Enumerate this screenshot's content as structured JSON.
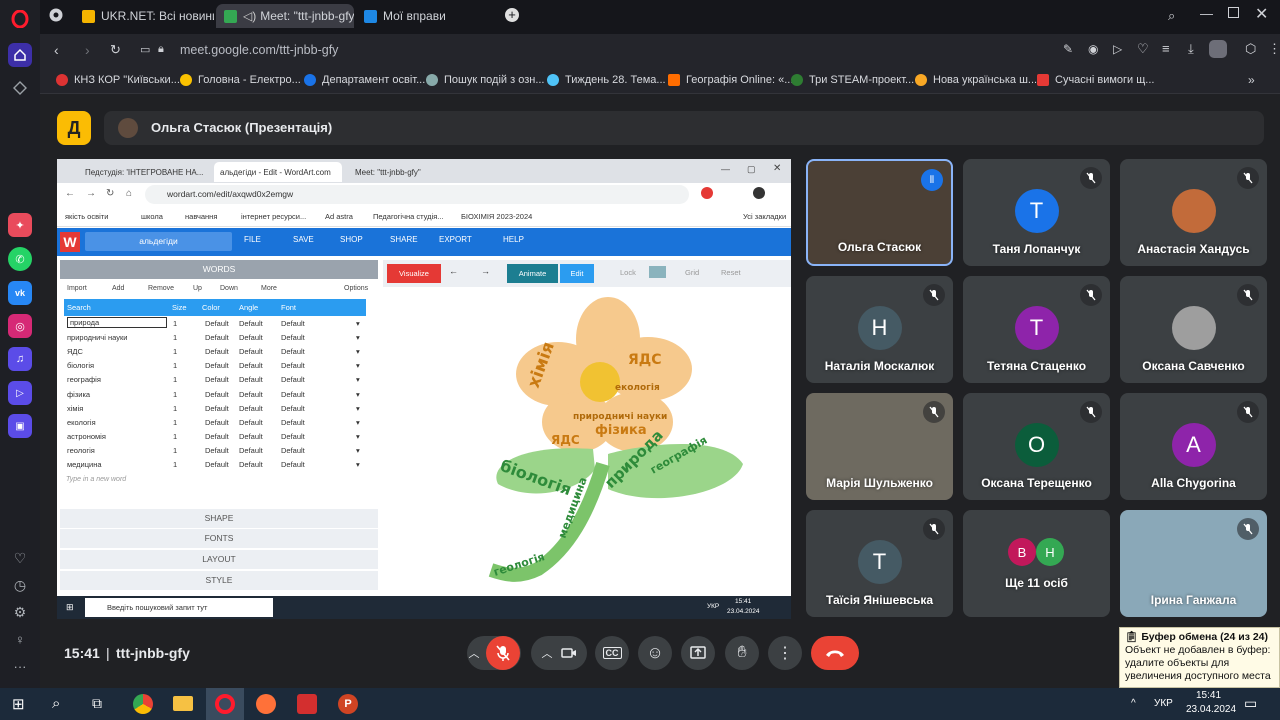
{
  "browser": {
    "tabs": [
      {
        "label": "UKR.NET: Всі новини Укр"
      },
      {
        "label": "Meet: \"ttt-jnbb-gfy\""
      },
      {
        "label": "Мої вправи"
      }
    ],
    "url": "meet.google.com/ttt-jnbb-gfy",
    "bookmarks": [
      "КНЗ КОР \"Київськи...",
      "Головна - Електро...",
      "Департамент освіт...",
      "Пошук подій з озн...",
      "Тиждень 28. Тема...",
      "Географія Online: «...",
      "Три STEAM-проект...",
      "Нова українська ш...",
      "Сучасні вимоги щ..."
    ]
  },
  "meet": {
    "logo_letter": "Д",
    "presenter": "Ольга Стасюк (Презентація)",
    "time": "15:41",
    "code": "ttt-jnbb-gfy",
    "participants": [
      {
        "name": "Ольга Стасюк",
        "initial": "",
        "color": "#6b5a4c"
      },
      {
        "name": "Таня Лопанчук",
        "initial": "Т",
        "color": "#1a73e8"
      },
      {
        "name": "Анастасія Хандусь",
        "initial": "",
        "color": "#c26b3a"
      },
      {
        "name": "Наталія Москалюк",
        "initial": "Н",
        "color": "#455a64"
      },
      {
        "name": "Тетяна Стаценко",
        "initial": "Т",
        "color": "#8e24aa"
      },
      {
        "name": "Оксана Савченко",
        "initial": "",
        "color": "#9e9e9e"
      },
      {
        "name": "Марія Шульженко",
        "initial": "",
        "color": "#7a6a58"
      },
      {
        "name": "Оксана Терещенко",
        "initial": "О",
        "color": "#0b5d3b"
      },
      {
        "name": "Alla Chygorina",
        "initial": "A",
        "color": "#8e24aa"
      },
      {
        "name": "Таїсія Янішевська",
        "initial": "Т",
        "color": "#455a64"
      },
      {
        "name": "Ще 11 осіб",
        "initial": "",
        "color": "#3c4043"
      },
      {
        "name": "Ірина Ганжала",
        "initial": "",
        "color": "#6f93a8"
      }
    ],
    "more_avatars": [
      "В",
      "Н"
    ]
  },
  "shared": {
    "tabs": [
      "Педстудія: 'ІНТЕГРОВАНЕ НА...",
      "альдегіди - Edit - WordArt.com",
      "Meet: \"ttt-jnbb-gfy\""
    ],
    "url": "wordart.com/edit/axqwd0x2emgw",
    "bookmarks": [
      "якість освіти",
      "школа",
      "навчання",
      "інтернет ресурси...",
      "Ad astra",
      "Педагогічна студія...",
      "БІОХІМІЯ 2023-2024",
      "Усі закладки"
    ],
    "wordart": {
      "title": "альдегіди",
      "menu": [
        "FILE",
        "SAVE",
        "SHOP",
        "SHARE",
        "EXPORT",
        "HELP"
      ],
      "words_header": "WORDS",
      "toolbar": [
        "Import",
        "Add",
        "Remove",
        "Up",
        "Down",
        "More",
        "Options"
      ],
      "columns": [
        "Search",
        "Size",
        "Color",
        "Angle",
        "Font"
      ],
      "rows": [
        {
          "word": "природа",
          "size": "1",
          "color": "Default",
          "angle": "Default",
          "font": "Default"
        },
        {
          "word": "природничі науки",
          "size": "1",
          "color": "Default",
          "angle": "Default",
          "font": "Default"
        },
        {
          "word": "ЯДС",
          "size": "1",
          "color": "Default",
          "angle": "Default",
          "font": "Default"
        },
        {
          "word": "біологія",
          "size": "1",
          "color": "Default",
          "angle": "Default",
          "font": "Default"
        },
        {
          "word": "географія",
          "size": "1",
          "color": "Default",
          "angle": "Default",
          "font": "Default"
        },
        {
          "word": "фізика",
          "size": "1",
          "color": "Default",
          "angle": "Default",
          "font": "Default"
        },
        {
          "word": "хімія",
          "size": "1",
          "color": "Default",
          "angle": "Default",
          "font": "Default"
        },
        {
          "word": "екологія",
          "size": "1",
          "color": "Default",
          "angle": "Default",
          "font": "Default"
        },
        {
          "word": "астрономія",
          "size": "1",
          "color": "Default",
          "angle": "Default",
          "font": "Default"
        },
        {
          "word": "геологія",
          "size": "1",
          "color": "Default",
          "angle": "Default",
          "font": "Default"
        },
        {
          "word": "медицина",
          "size": "1",
          "color": "Default",
          "angle": "Default",
          "font": "Default"
        }
      ],
      "new_word_placeholder": "Type in a new word",
      "sections": [
        "SHAPE",
        "FONTS",
        "LAYOUT",
        "STYLE"
      ],
      "canvas_toolbar": [
        "Visualize",
        "Animate",
        "Edit",
        "Lock",
        "Grid",
        "Reset"
      ]
    },
    "taskbar": {
      "search": "Введіть пошуковий запит тут",
      "lang": "УКР",
      "time": "15:41",
      "date": "23.04.2024"
    }
  },
  "clipboard": {
    "title": "Буфер обмена (24 из 24)",
    "message": "Объект не добавлен в буфер: удалите объекты для увеличения доступного места"
  },
  "taskbar": {
    "lang": "УКР",
    "time": "15:41",
    "date": "23.04.2024"
  }
}
